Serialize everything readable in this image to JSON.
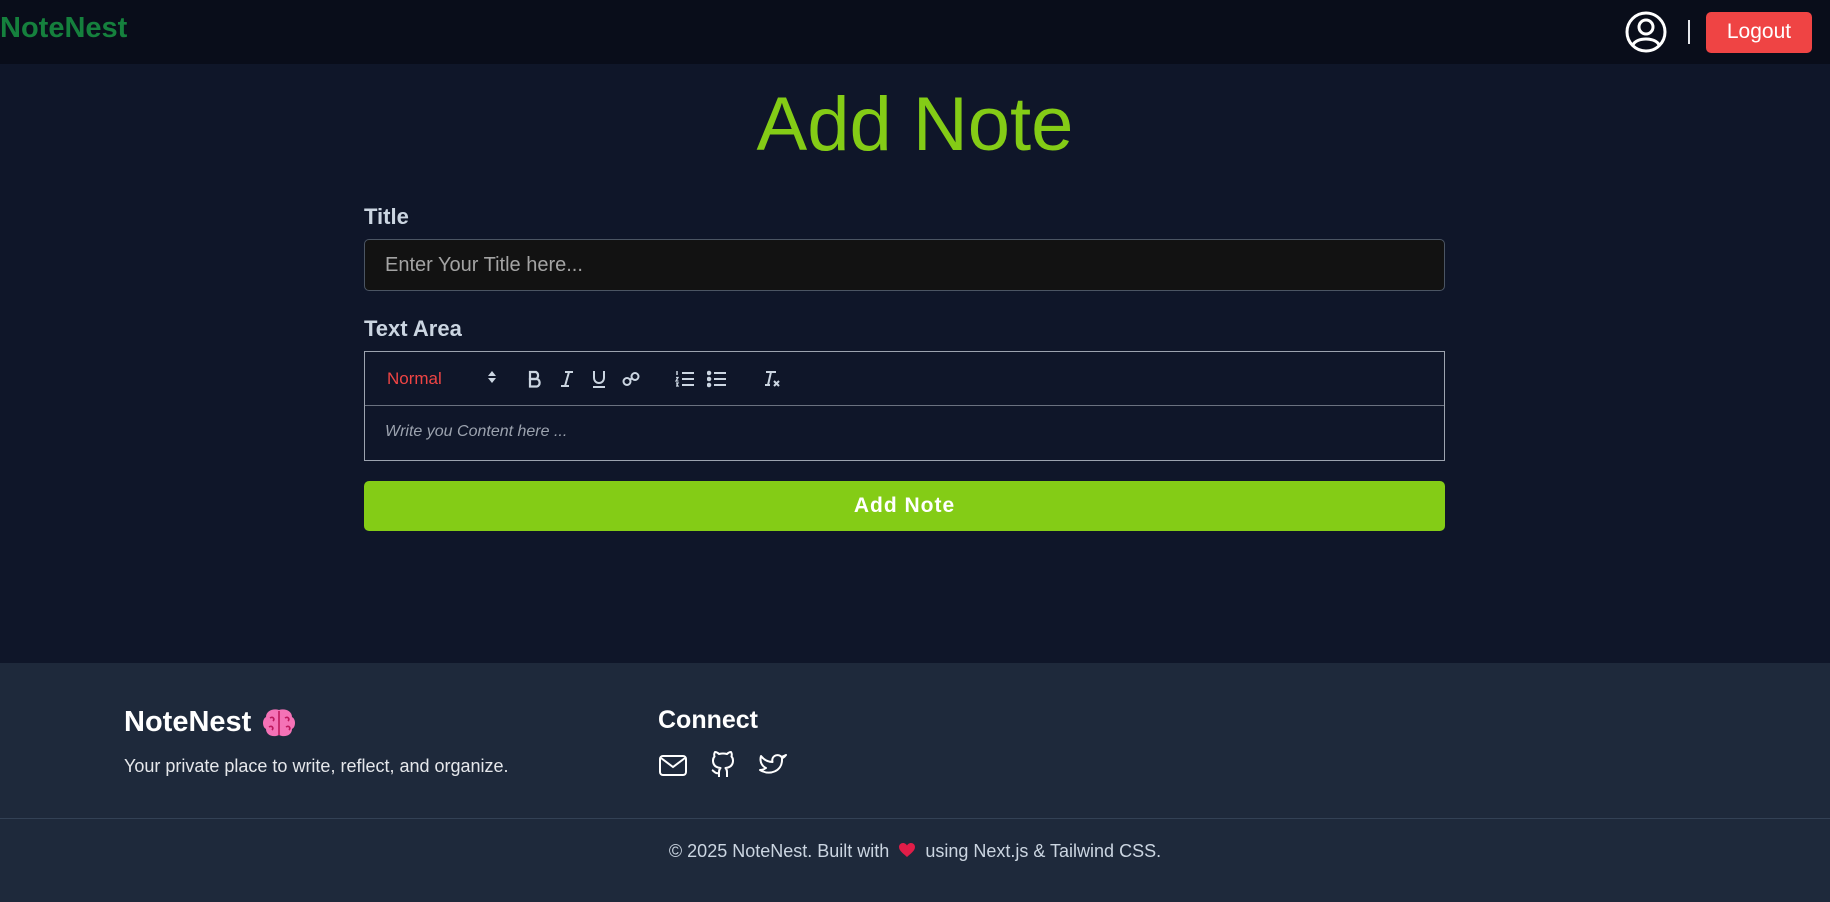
{
  "header": {
    "brand": "NoteNest",
    "logout_label": "Logout",
    "user_icon": "user-circle-icon"
  },
  "main": {
    "page_title": "Add Note",
    "title_label": "Title",
    "title_placeholder": "Enter Your Title here...",
    "text_area_label": "Text Area",
    "editor": {
      "header_select_value": "Normal",
      "toolbar_icons": [
        "bold-icon",
        "italic-icon",
        "underline-icon",
        "link-icon",
        "ordered-list-icon",
        "bullet-list-icon",
        "clear-format-icon"
      ],
      "placeholder": "Write you Content here ..."
    },
    "submit_label": "Add Note"
  },
  "footer": {
    "brand": "NoteNest",
    "brand_icon": "brain-icon",
    "tagline": "Your private place to write, reflect, and organize.",
    "connect_heading": "Connect",
    "social_icons": [
      "mail-icon",
      "github-icon",
      "twitter-icon"
    ],
    "copyright_prefix": "© 2025 NoteNest. Built with",
    "copyright_suffix": "using Next.js & Tailwind CSS."
  },
  "colors": {
    "accent": "#84cc16",
    "brand": "#15803d",
    "danger": "#ef4444",
    "background": "#0f172a",
    "footer": "#1e293b"
  }
}
